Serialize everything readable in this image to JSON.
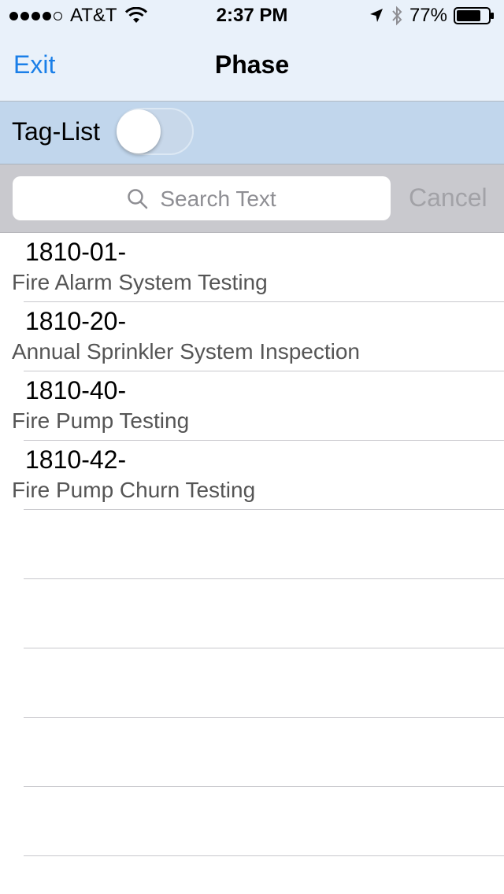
{
  "status_bar": {
    "carrier": "AT&T",
    "time": "2:37 PM",
    "battery": "77%",
    "battery_level": 0.77,
    "signal_bars": 4,
    "signal_total": 5,
    "icons": [
      "wifi-icon",
      "location-arrow-icon",
      "bluetooth-icon",
      "battery-icon"
    ]
  },
  "nav": {
    "exit_label": "Exit",
    "title": "Phase"
  },
  "tag_list": {
    "label": "Tag-List",
    "toggle_on": false
  },
  "search": {
    "placeholder": "Search Text",
    "cancel_label": "Cancel"
  },
  "colors": {
    "accent": "#1a7fe8",
    "nav_bg": "#e9f1fa",
    "tag_bar_bg": "#c1d6ec",
    "search_bar_bg": "#c9c9ce"
  },
  "items": [
    {
      "code": "1810-01-",
      "description": "Fire Alarm System Testing"
    },
    {
      "code": "1810-20-",
      "description": "Annual Sprinkler System Inspection"
    },
    {
      "code": "1810-40-",
      "description": "Fire Pump Testing"
    },
    {
      "code": "1810-42-",
      "description": "Fire Pump Churn Testing"
    }
  ]
}
